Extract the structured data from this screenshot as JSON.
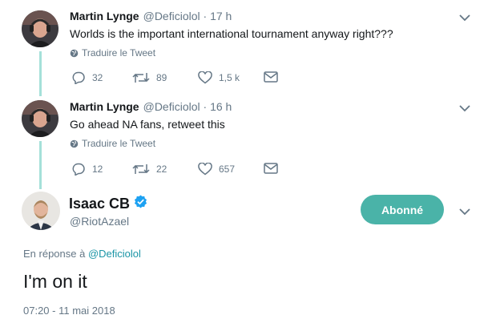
{
  "thread": [
    {
      "author_name": "Martin Lynge",
      "handle": "@Deficiolol",
      "separator": "·",
      "time": "17 h",
      "text": "Worlds is the important international tournament anyway right???",
      "translate_label": "Traduire le Tweet",
      "replies": "32",
      "retweets": "89",
      "likes": "1,5 k",
      "avatar_icon": "avatar-photo"
    },
    {
      "author_name": "Martin Lynge",
      "handle": "@Deficiolol",
      "separator": "·",
      "time": "16 h",
      "text": "Go ahead NA fans, retweet this",
      "translate_label": "Traduire le Tweet",
      "replies": "12",
      "retweets": "22",
      "likes": "657",
      "avatar_icon": "avatar-photo"
    }
  ],
  "main_tweet": {
    "author_name": "Isaac CB",
    "handle": "@RiotAzael",
    "verified_icon": "verified-badge-icon",
    "follow_label": "Abonné",
    "reply_prefix": "En réponse à",
    "reply_to": "@Deficiolol",
    "text": "I'm on it",
    "timestamp": "07:20 - 11 mai 2018"
  },
  "colors": {
    "accent": "#4ab3a8",
    "thread_line": "#a5e0d9",
    "link": "#1b95a6",
    "muted": "#657786",
    "text": "#14171a"
  }
}
